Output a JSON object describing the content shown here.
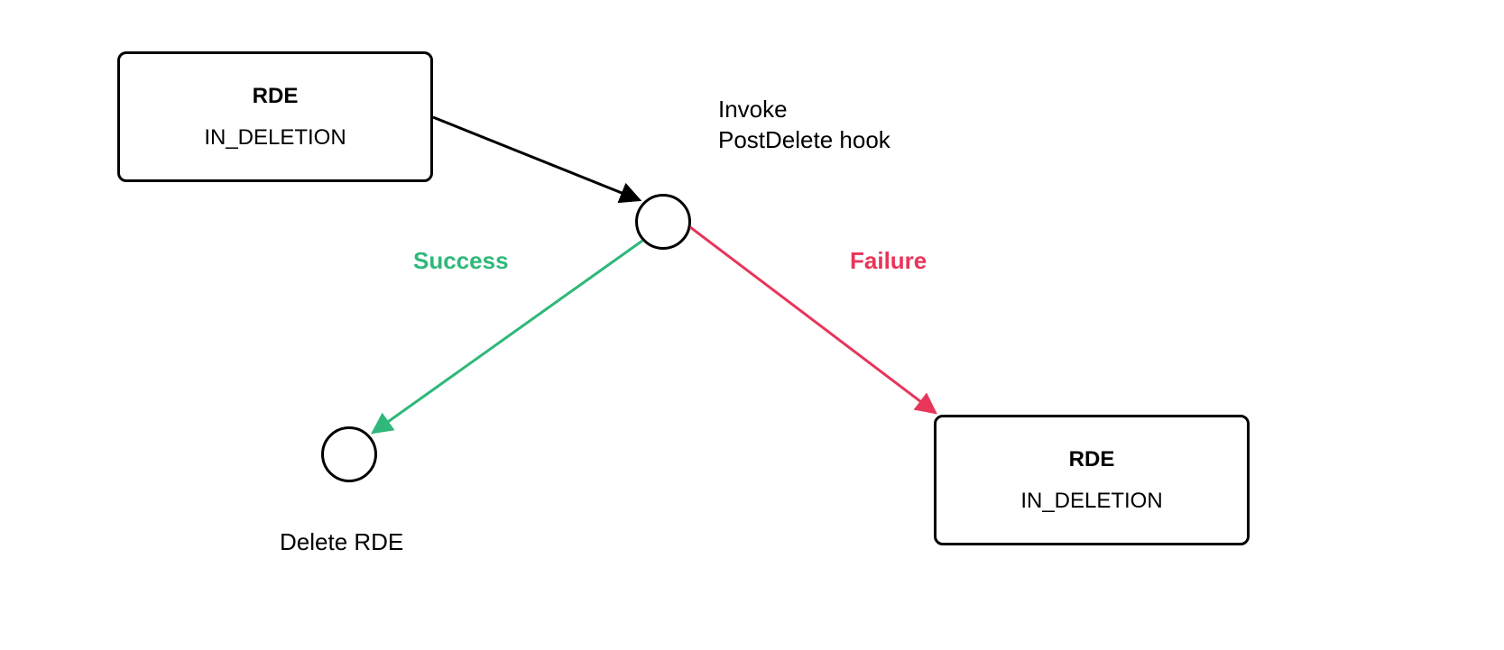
{
  "nodes": {
    "start_box": {
      "title": "RDE",
      "subtitle": "IN_DELETION"
    },
    "hook_circle": {
      "label_line1": "Invoke",
      "label_line2": "PostDelete hook"
    },
    "delete_circle": {
      "label": "Delete RDE"
    },
    "end_box": {
      "title": "RDE",
      "subtitle": "IN_DELETION"
    }
  },
  "edges": {
    "success": {
      "label": "Success",
      "color": "#2fb87a"
    },
    "failure": {
      "label": "Failure",
      "color": "#e8355a"
    }
  }
}
